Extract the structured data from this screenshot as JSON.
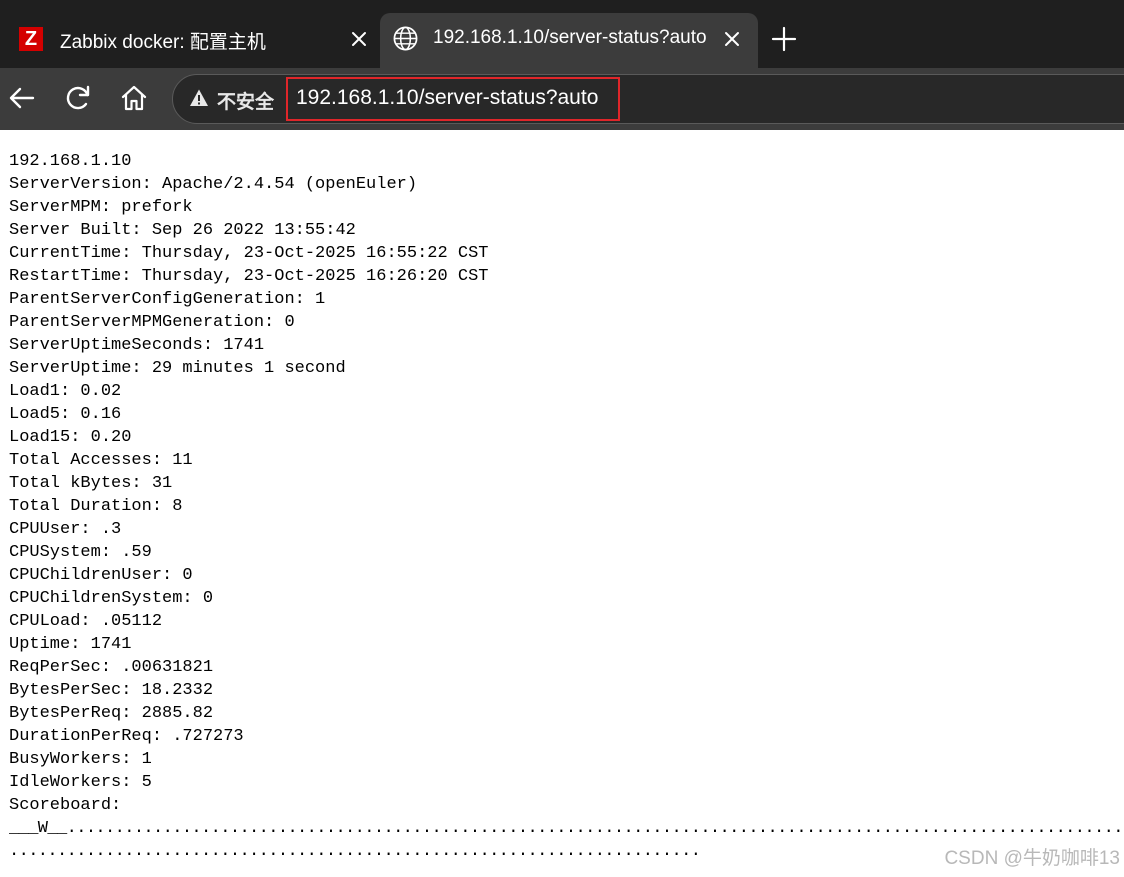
{
  "tabs": [
    {
      "title": "Zabbix docker: 配置主机",
      "favicon_letter": "Z",
      "favicon": "zabbix-icon",
      "active": false
    },
    {
      "title": "192.168.1.10/server-status?auto",
      "favicon": "globe-icon",
      "active": true
    }
  ],
  "toolbar": {
    "security_label": "不安全",
    "url": "192.168.1.10/server-status?auto"
  },
  "page": {
    "lines": [
      "192.168.1.10",
      "ServerVersion: Apache/2.4.54 (openEuler)",
      "ServerMPM: prefork",
      "Server Built: Sep 26 2022 13:55:42",
      "CurrentTime: Thursday, 23-Oct-2025 16:55:22 CST",
      "RestartTime: Thursday, 23-Oct-2025 16:26:20 CST",
      "ParentServerConfigGeneration: 1",
      "ParentServerMPMGeneration: 0",
      "ServerUptimeSeconds: 1741",
      "ServerUptime: 29 minutes 1 second",
      "Load1: 0.02",
      "Load5: 0.16",
      "Load15: 0.20",
      "Total Accesses: 11",
      "Total kBytes: 31",
      "Total Duration: 8",
      "CPUUser: .3",
      "CPUSystem: .59",
      "CPUChildrenUser: 0",
      "CPUChildrenSystem: 0",
      "CPULoad: .05112",
      "Uptime: 1741",
      "ReqPerSec: .00631821",
      "BytesPerSec: 18.2332",
      "BytesPerReq: 2885.82",
      "DurationPerReq: .727273",
      "BusyWorkers: 1",
      "IdleWorkers: 5",
      "Scoreboard:"
    ],
    "scoreboard_1": "___W__..............................................................................................................",
    "scoreboard_2": "........................................................................"
  },
  "watermark": "CSDN @牛奶咖啡13",
  "colors": {
    "tabstrip": "#1f1f1f",
    "toolbar": "#3c3c3c",
    "url_highlight": "#e0262a",
    "zabbix_red": "#d40000"
  }
}
